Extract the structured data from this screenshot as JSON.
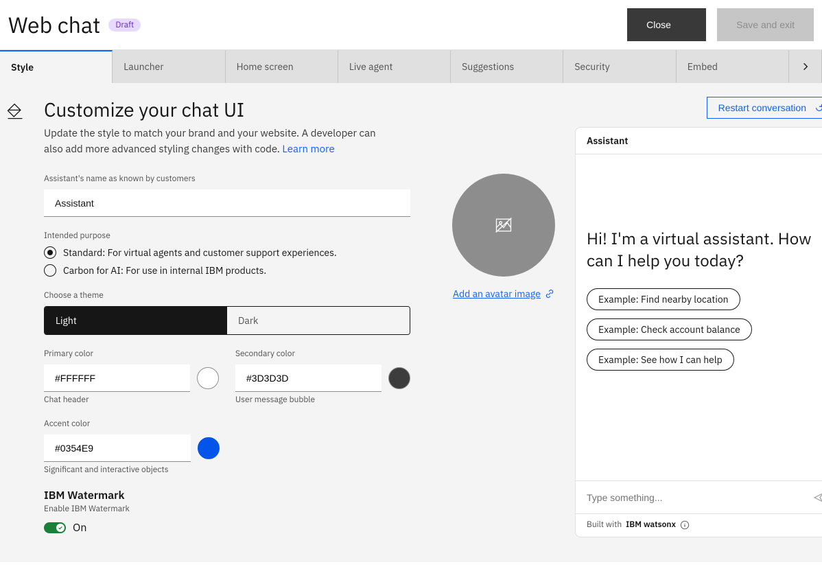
{
  "header": {
    "title": "Web chat",
    "badge": "Draft",
    "close": "Close",
    "save": "Save and exit"
  },
  "tabs": [
    "Style",
    "Launcher",
    "Home screen",
    "Live agent",
    "Suggestions",
    "Security",
    "Embed"
  ],
  "section": {
    "title": "Customize your chat UI",
    "desc": "Update the style to match your brand and your website. A developer can also add more advanced styling changes with code. ",
    "learn": "Learn more"
  },
  "form": {
    "nameLabel": "Assistant's name as known by customers",
    "nameValue": "Assistant",
    "purposeLabel": "Intended purpose",
    "purpose1": "Standard: For virtual agents and customer support experiences.",
    "purpose2": "Carbon for AI: For use in internal IBM products.",
    "themeLabel": "Choose a theme",
    "themeLight": "Light",
    "themeDark": "Dark",
    "primaryLabel": "Primary color",
    "primaryValue": "#FFFFFF",
    "primaryHelper": "Chat header",
    "secondaryLabel": "Secondary color",
    "secondaryValue": "#3D3D3D",
    "secondaryHelper": "User message bubble",
    "accentLabel": "Accent color",
    "accentValue": "#0354E9",
    "accentHelper": "Significant and interactive objects",
    "watermarkTitle": "IBM Watermark",
    "watermarkDesc": "Enable IBM Watermark",
    "toggleLabel": "On",
    "avatarLink": "Add an avatar image"
  },
  "preview": {
    "restart": "Restart conversation",
    "header": "Assistant",
    "welcome": "Hi! I'm a virtual assistant. How can I help you today?",
    "sugg1": "Example: Find nearby location",
    "sugg2": "Example: Check account balance",
    "sugg3": "Example: See how I can help",
    "inputPlaceholder": "Type something...",
    "footerPrefix": "Built with ",
    "footerBrand": "IBM watsonx"
  }
}
